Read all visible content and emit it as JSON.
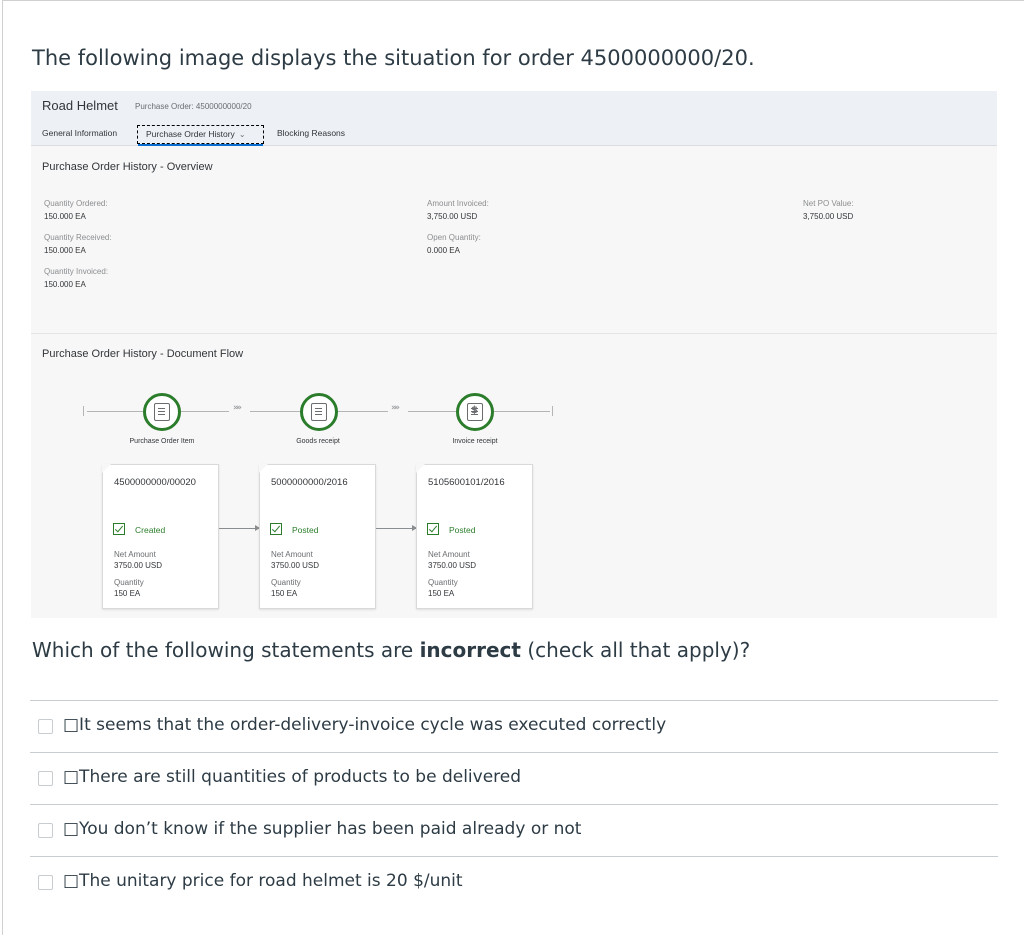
{
  "question": {
    "intro": "The following image displays the situation for order 4500000000/20.",
    "prompt_pre": "Which of the following statements are ",
    "prompt_bold": "incorrect",
    "prompt_post": " (check all that apply)?"
  },
  "sap": {
    "object_title": "Road Helmet",
    "object_subtitle": "Purchase Order: 4500000000/20",
    "tabs": {
      "general": "General Information",
      "history": "Purchase Order History",
      "blocking": "Blocking Reasons"
    },
    "overview": {
      "title": "Purchase Order History - Overview",
      "qty_ordered_label": "Quantity Ordered:",
      "qty_ordered_value": "150.000 EA",
      "qty_received_label": "Quantity Received:",
      "qty_received_value": "150.000 EA",
      "qty_invoiced_label": "Quantity Invoiced:",
      "qty_invoiced_value": "150.000 EA",
      "amount_invoiced_label": "Amount Invoiced:",
      "amount_invoiced_value": "3,750.00  USD",
      "open_qty_label": "Open Quantity:",
      "open_qty_value": "0.000 EA",
      "net_po_label": "Net PO Value:",
      "net_po_value": "3,750.00  USD"
    },
    "flow": {
      "title": "Purchase Order History - Document Flow",
      "chevrons": "»»",
      "nodes": [
        {
          "label": "Purchase Order Item",
          "icon": "document-icon"
        },
        {
          "label": "Goods receipt",
          "icon": "document-icon"
        },
        {
          "label": "Invoice receipt",
          "icon": "invoice-icon"
        }
      ],
      "dollar_glyph": "$",
      "cards": [
        {
          "id": "4500000000/00020",
          "status": "Created",
          "net_label": "Net Amount",
          "net_value": "3750.00 USD",
          "qty_label": "Quantity",
          "qty_value": "150 EA"
        },
        {
          "id": "5000000000/2016",
          "status": "Posted",
          "net_label": "Net Amount",
          "net_value": "3750.00 USD",
          "qty_label": "Quantity",
          "qty_value": "150 EA"
        },
        {
          "id": "5105600101/2016",
          "status": "Posted",
          "net_label": "Net Amount",
          "net_value": "3750.00 USD",
          "qty_label": "Quantity",
          "qty_value": "150 EA"
        }
      ],
      "status_color": "#2b7d2b"
    }
  },
  "answers": [
    {
      "text": "□It seems that the order-delivery-invoice cycle was executed correctly"
    },
    {
      "text": "□There are still quantities of products to be delivered"
    },
    {
      "text": "□You don’t know if the supplier has been paid already or not"
    },
    {
      "text": "□The unitary price for road helmet is 20 $/unit"
    }
  ]
}
